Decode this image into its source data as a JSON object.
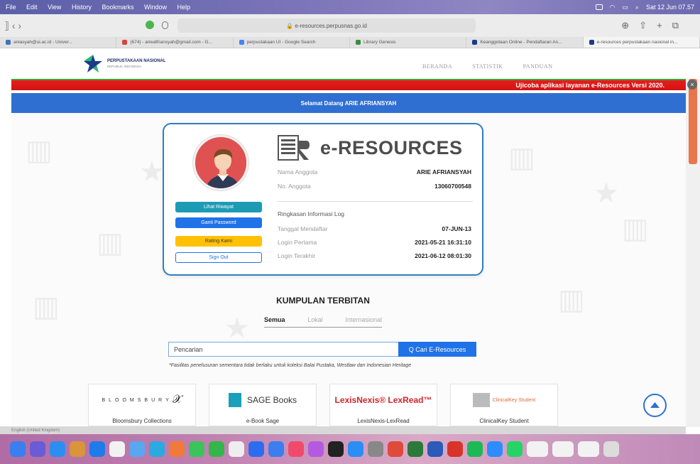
{
  "menubar": {
    "items": [
      "File",
      "Edit",
      "View",
      "History",
      "Bookmarks",
      "Window",
      "Help"
    ],
    "clock": "Sat 12 Jun 07.57"
  },
  "browser": {
    "url": "e-resources.perpusnas.go.id",
    "tabs": [
      {
        "label": "aniasyah@ui.ac.id - Univer...",
        "color": "#3b73c4"
      },
      {
        "label": "(674) - ariealfriansyah@gmail.com - G...",
        "color": "#d44638"
      },
      {
        "label": "perpustakaan UI - Google Search",
        "color": "#4285f4"
      },
      {
        "label": "Library Genesis",
        "color": "#3a8e3a"
      },
      {
        "label": "Keanggotaan Online - Pendaftaran An...",
        "color": "#1a3a8b"
      },
      {
        "label": "e-resources perpustakaan nasional in...",
        "color": "#1a3a8b"
      }
    ]
  },
  "site": {
    "logo_title": "PERPUSTAKAAN NASIONAL",
    "logo_sub": "REPUBLIK INDONESIA",
    "nav": [
      "BERANDA",
      "STATISTIK",
      "PANDUAN"
    ],
    "banner": "Ujicoba aplikasi layanan e-Resources Versi 2020.",
    "welcome": "Selamat Datang ARIE AFRIANSYAH"
  },
  "profile": {
    "brand": "e-RESOURCES",
    "nama_label": "Nama Anggota",
    "nama": "ARIE AFRIANSYAH",
    "no_label": "No. Anggota",
    "no": "13060700548",
    "log_title": "Ringkasan Informasi Log",
    "daftar_label": "Tanggal Mendaftar",
    "daftar": "07-JUN-13",
    "pertama_label": "Login Pertama",
    "pertama": "2021-05-21 16:31:10",
    "terakhir_label": "Login Terakhir",
    "terakhir": "2021-06-12 08:01:30",
    "buttons": {
      "riwayat": "Lihat Riwayat",
      "password": "Ganti Password",
      "rating": "Rating Kami",
      "signout": "Sign Out"
    }
  },
  "collections": {
    "title": "KUMPULAN TERBITAN",
    "tabs": [
      "Semua",
      "Lokal",
      "Internasional"
    ],
    "search_value": "Pencarian",
    "search_button": "Q Cari E-Resources",
    "note": "*Fasilitas penelusuran sementara tidak berlaku untuk koleksi Balai Pustaka, Westlaw dan Indonesian Heritage",
    "items": [
      {
        "logo": "BLOOMSBURY",
        "name": "Bloomsbury Collections"
      },
      {
        "logo": "SAGE Books",
        "name": "e-Book Sage"
      },
      {
        "logo": "LexisNexis® LexRead™",
        "name": "LexisNexis-LexRead"
      },
      {
        "logo": "ClinicalKey Student",
        "name": "ClinicalKey Student"
      }
    ]
  },
  "statusbar": {
    "text": "English (United Kingdom)"
  },
  "colors": {
    "red": "#d21414",
    "blue": "#2f6fd1",
    "teal": "#1d9bb5",
    "yellow": "#ffc107"
  }
}
